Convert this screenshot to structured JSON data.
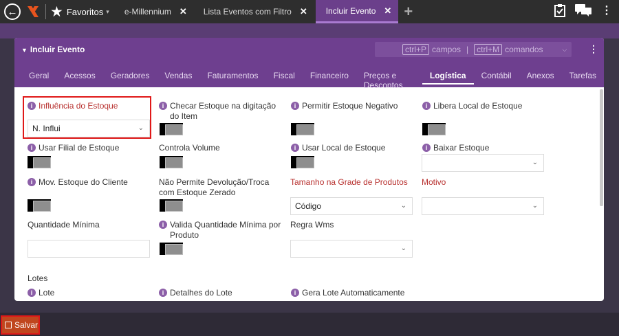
{
  "topbar": {
    "back_icon": "back-circle-icon",
    "favorites_label": "Favoritos",
    "tabs": [
      {
        "label": "e-Millennium",
        "active": false
      },
      {
        "label": "Lista Eventos com Filtro",
        "active": false
      },
      {
        "label": "Incluir Evento",
        "active": true
      }
    ],
    "add_tab_icon": "plus-icon",
    "right_icons": [
      "clipboard-check-icon",
      "chat-icon",
      "more-vertical-icon"
    ]
  },
  "panel": {
    "title": "Incluir Evento",
    "hint_fields_key": "ctrl+P",
    "hint_fields_label": "campos",
    "hint_sep": "|",
    "hint_commands_key": "ctrl+M",
    "hint_commands_label": "comandos",
    "tabs": [
      "Geral",
      "Acessos",
      "Geradores",
      "Vendas",
      "Faturamentos",
      "Fiscal",
      "Financeiro",
      "Preços e Descontos",
      "Logística",
      "Contábil",
      "Anexos",
      "Tarefas"
    ],
    "active_tab": "Logística"
  },
  "form": {
    "influencia_estoque": {
      "label": "Influência do Estoque",
      "value": "N. Influi"
    },
    "checar_estoque": {
      "label": "Checar Estoque na digitação do Item"
    },
    "permitir_negativo": {
      "label": "Permitir Estoque Negativo"
    },
    "libera_local": {
      "label": "Libera Local de Estoque"
    },
    "usar_filial": {
      "label": "Usar Filial de Estoque"
    },
    "controla_volume": {
      "label": "Controla Volume"
    },
    "usar_local": {
      "label": "Usar Local de Estoque"
    },
    "baixar_estoque": {
      "label": "Baixar Estoque",
      "value": ""
    },
    "mov_estoque_cliente": {
      "label": "Mov. Estoque do Cliente"
    },
    "nao_permite_devolucao": {
      "label": "Não Permite Devolução/Troca com Estoque Zerado"
    },
    "tamanho_grade": {
      "label": "Tamanho na Grade de Produtos",
      "value": "Código"
    },
    "motivo": {
      "label": "Motivo",
      "value": ""
    },
    "quantidade_minima": {
      "label": "Quantidade Mínima",
      "value": ""
    },
    "valida_quantidade": {
      "label": "Valida Quantidade Mínima por Produto"
    },
    "regra_wms": {
      "label": "Regra Wms",
      "value": ""
    },
    "lotes_section": "Lotes",
    "lote": {
      "label": "Lote"
    },
    "detalhes_lote": {
      "label": "Detalhes do Lote"
    },
    "gera_lote": {
      "label": "Gera Lote Automaticamente"
    }
  },
  "footer": {
    "save_label": "Salvar"
  },
  "colors": {
    "accent": "#6e3f8f",
    "save": "#c0461e",
    "required": "#b8312f"
  }
}
